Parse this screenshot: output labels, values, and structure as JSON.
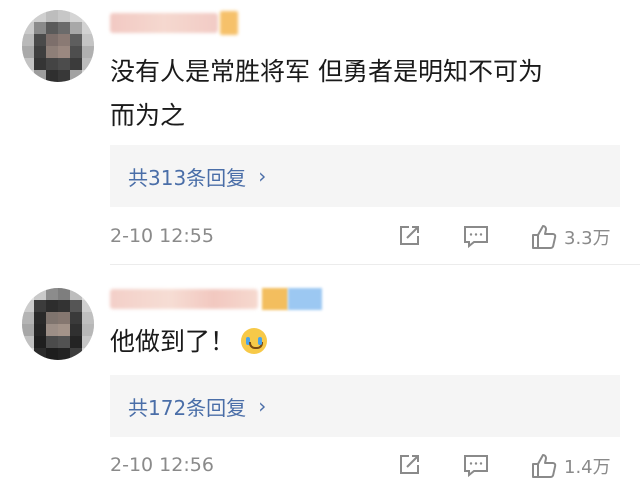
{
  "comments": [
    {
      "text_line1": "没有人是常胜将军 但勇者是明知不可为",
      "text_line2": "而为之",
      "replies_label": "共313条回复",
      "time": "2-10 12:55",
      "likes": "3.3万"
    },
    {
      "text_line1": "他做到了！",
      "replies_label": "共172条回复",
      "time": "2-10 12:56",
      "likes": "1.4万"
    }
  ],
  "icons": {
    "reply_chevron": "chevron-right-icon",
    "share": "share-icon",
    "comment": "comment-icon",
    "like": "thumbs-up-icon",
    "emoji": "crying-face-emoji"
  },
  "colors": {
    "link": "#4a6ea8",
    "meta": "#8a8a8a",
    "reply_box_bg": "#f5f5f5"
  }
}
